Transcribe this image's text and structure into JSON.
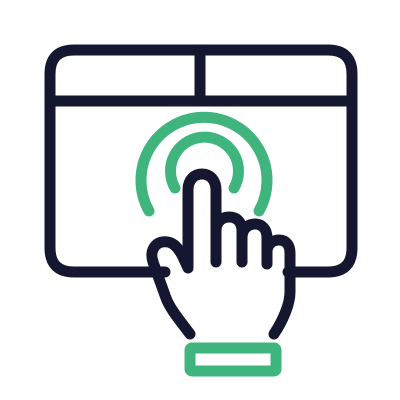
{
  "icon": {
    "name": "touchpad-tap-icon",
    "parts": [
      "touchpad-frame",
      "touchpad-left-button",
      "touchpad-right-button",
      "tap-waves",
      "pointing-hand",
      "cuff"
    ]
  },
  "colors": {
    "outline": "#14172f",
    "accent": "#3fb47d",
    "background": "#ffffff"
  }
}
